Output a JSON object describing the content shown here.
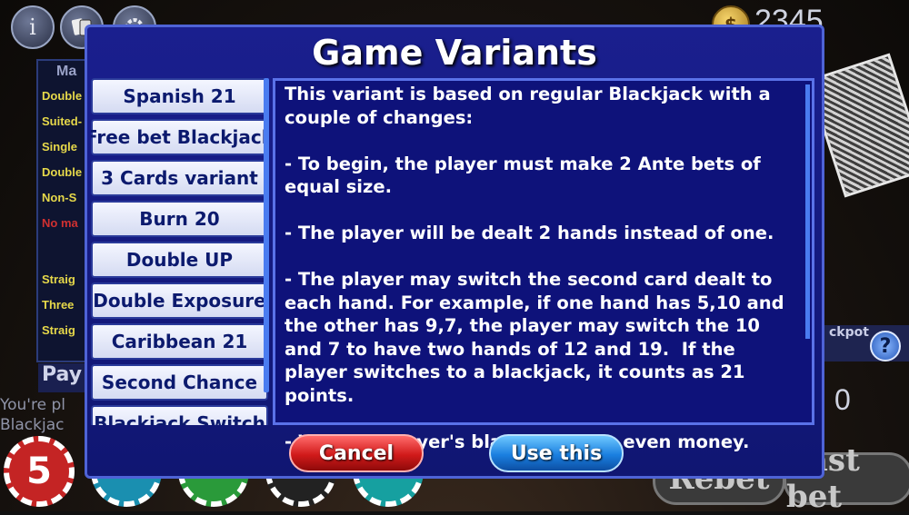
{
  "background": {
    "info_glyph": "i",
    "balance": "2345",
    "coin_glyph": "$",
    "panel_title": "Ma",
    "side_labels": [
      {
        "text": "Double",
        "color": "#e6d84a"
      },
      {
        "text": "Suited-",
        "color": "#e6d84a"
      },
      {
        "text": "Single",
        "color": "#e6d84a"
      },
      {
        "text": "Double",
        "color": "#e6d84a"
      },
      {
        "text": "Non-S",
        "color": "#e6d84a"
      },
      {
        "text": "No ma",
        "color": "#d03030"
      },
      {
        "text": "Straig",
        "color": "#e6d84a"
      },
      {
        "text": "Three",
        "color": "#e6d84a"
      },
      {
        "text": "Straig",
        "color": "#e6d84a"
      }
    ],
    "pay_label": "Pay",
    "hint_line1": "You're pl",
    "hint_line2": "Blackjac",
    "jackpot_label": "ckpot",
    "jackpot_value": "0",
    "chip_value": "5",
    "rebet_label": "Rebet",
    "last_bet_label": "Last bet",
    "icons": [
      "info-icon",
      "cards-icon",
      "gear-icon",
      "coin-icon",
      "help-icon"
    ]
  },
  "dialog": {
    "title": "Game Variants",
    "variants": [
      "Spanish 21",
      "Free bet Blackjack",
      "3 Cards variant",
      "Burn 20",
      "Double UP",
      "Double Exposure",
      "Caribbean 21",
      "Second Chance",
      "Blackjack Switch"
    ],
    "description": "This variant is based on regular Blackjack with a couple of changes:\n\n- To begin, the player must make 2 Ante bets of equal size.\n\n- The player will be dealt 2 hands instead of one.\n\n- The player may switch the second card dealt to each hand. For example, if one hand has 5,10 and the other has 9,7, the player may switch the 10 and 7 to have two hands of 12 and 19.  If the player switches to a blackjack, it counts as 21 points.\n\n- Winning player's blackjacks pay even money.",
    "cancel_label": "Cancel",
    "use_label": "Use this"
  }
}
